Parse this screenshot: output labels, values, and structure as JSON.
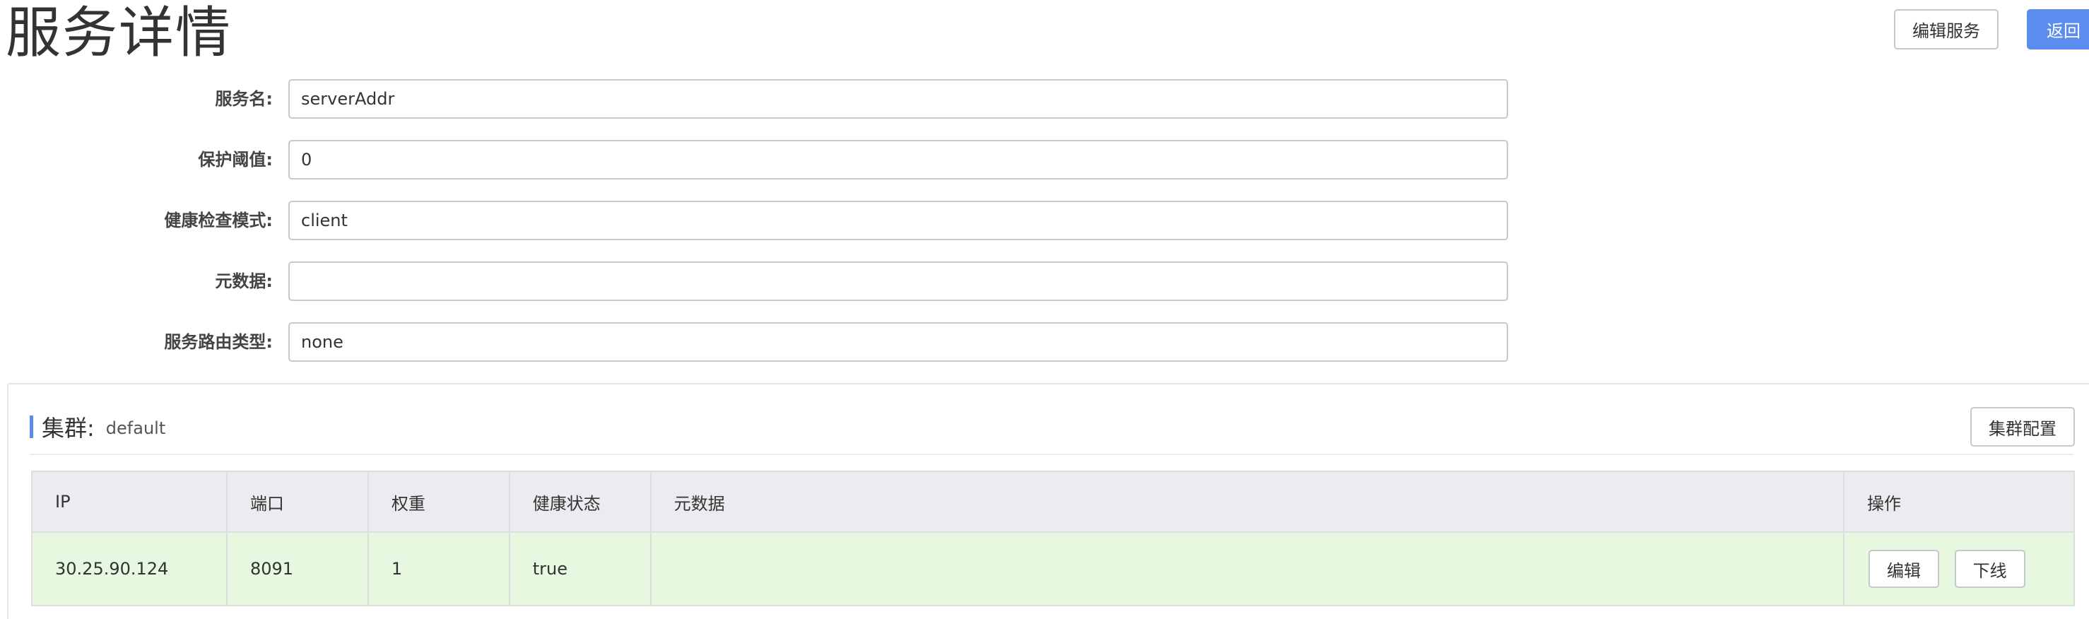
{
  "header": {
    "title": "服务详情",
    "edit_service_label": "编辑服务",
    "back_label": "返回"
  },
  "form": {
    "fields": [
      {
        "label": "服务名:",
        "value": "serverAddr"
      },
      {
        "label": "保护阈值:",
        "value": "0"
      },
      {
        "label": "健康检查模式:",
        "value": "client"
      },
      {
        "label": "元数据:",
        "value": ""
      },
      {
        "label": "服务路由类型:",
        "value": "none"
      }
    ]
  },
  "cluster": {
    "label": "集群:",
    "name": "default",
    "config_label": "集群配置",
    "table": {
      "columns": [
        "IP",
        "端口",
        "权重",
        "健康状态",
        "元数据",
        "操作"
      ],
      "rows": [
        {
          "ip": "30.25.90.124",
          "port": "8091",
          "weight": "1",
          "healthy": "true",
          "metadata": "",
          "edit_label": "编辑",
          "offline_label": "下线"
        }
      ]
    }
  },
  "colors": {
    "primary": "#5b8def",
    "header_row_bg": "#ebecef",
    "row_bg": "#e6f8df"
  }
}
